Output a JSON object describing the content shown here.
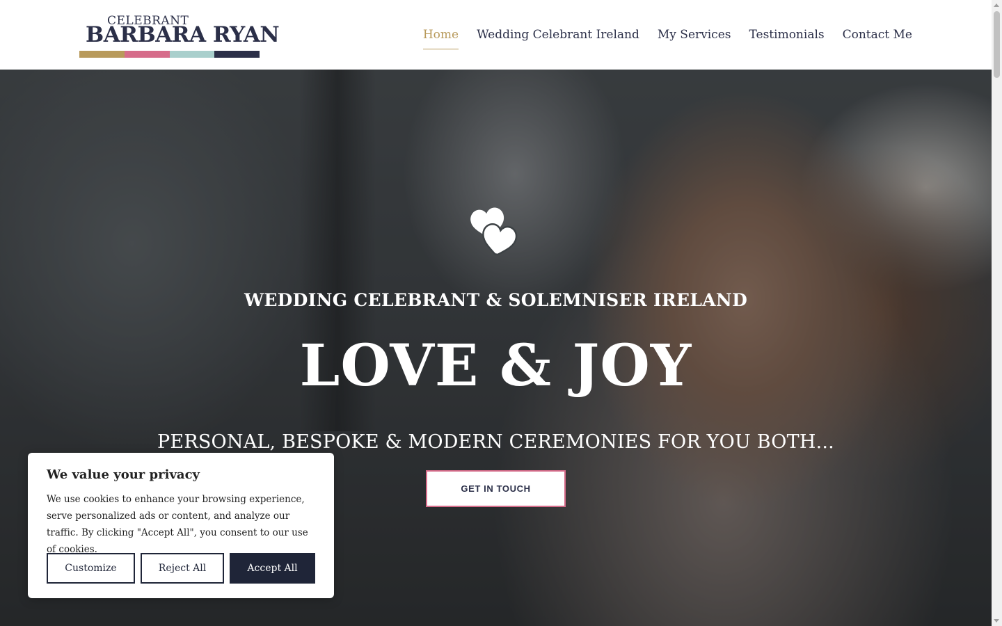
{
  "logo": {
    "small": "CELEBRANT",
    "big": "BARBARA RYAN",
    "stripe_colors": [
      "#b89a5b",
      "#d66c8a",
      "#a9cfcc",
      "#2b2f48"
    ]
  },
  "nav": {
    "items": [
      {
        "label": "Home",
        "active": true
      },
      {
        "label": "Wedding Celebrant Ireland",
        "active": false
      },
      {
        "label": "My Services",
        "active": false
      },
      {
        "label": "Testimonials",
        "active": false
      },
      {
        "label": "Contact Me",
        "active": false
      }
    ]
  },
  "hero": {
    "icon": "hearts-icon",
    "eyebrow": "WEDDING CELEBRANT & SOLEMNISER IRELAND",
    "title": "LOVE & JOY",
    "subtitle": "PERSONAL, BESPOKE & MODERN CEREMONIES FOR YOU BOTH...",
    "cta_label": "GET IN TOUCH"
  },
  "cookie_banner": {
    "title": "We value your privacy",
    "text": "We use cookies to enhance your browsing experience, serve personalized ads or content, and analyze our traffic. By clicking \"Accept All\", you consent to our use of cookies.",
    "buttons": {
      "customize": "Customize",
      "reject": "Reject All",
      "accept": "Accept All"
    }
  },
  "colors": {
    "accent_gold": "#b89a5b",
    "accent_pink": "#d66c8a",
    "navy": "#2b2f48"
  }
}
